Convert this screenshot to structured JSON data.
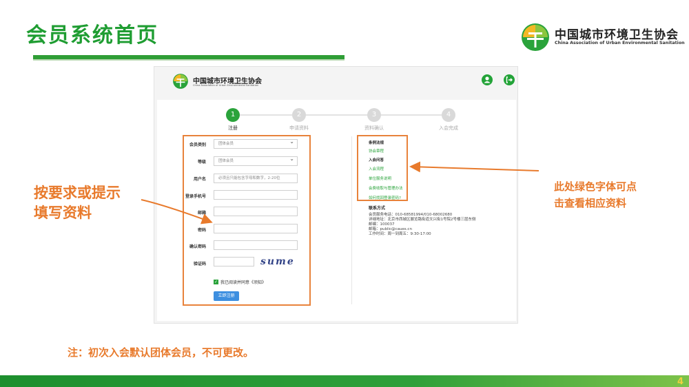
{
  "slide": {
    "title": "会员系统首页",
    "page_number": "4"
  },
  "brand": {
    "name_zh": "中国城市环境卫生协会",
    "name_en": "China Association of Urban Environmental Sanitation"
  },
  "screen": {
    "header_icons": [
      "user-icon",
      "logout-icon"
    ],
    "steps": [
      {
        "num": "1",
        "label": "注册",
        "active": true
      },
      {
        "num": "2",
        "label": "申请资料",
        "active": false
      },
      {
        "num": "3",
        "label": "资料确认",
        "active": false
      },
      {
        "num": "4",
        "label": "入会完成",
        "active": false
      }
    ],
    "form": {
      "member_type_label": "会员类别",
      "member_type_value": "团体会员",
      "level_label": "等级",
      "level_value": "团体会员",
      "username_label": "用户名",
      "username_placeholder": "必须且只能包含字母和数字，2-20位",
      "phone_label": "登录手机号",
      "email_label": "邮箱",
      "password_label": "密码",
      "confirm_label": "确认密码",
      "captcha_label": "验证码",
      "captcha_text": "sume",
      "agree_text": "我已阅读并同意《须知》",
      "submit_label": "立即注册"
    },
    "links": [
      {
        "text": "条例法规",
        "kind": "heading"
      },
      {
        "text": "协会章程",
        "kind": "link"
      },
      {
        "text": "入会问答",
        "kind": "heading"
      },
      {
        "text": "入会流程",
        "kind": "link"
      },
      {
        "text": "单位服务说明",
        "kind": "link"
      },
      {
        "text": "会费收取与管理办法",
        "kind": "link"
      },
      {
        "text": "如何找回登录密码?",
        "kind": "link"
      }
    ],
    "contact": {
      "title": "联系方式",
      "lines": [
        "会员服务电话：010-68581994/010-68002680",
        "详细地址：北京市西城区展览路街道文兴街1号院2号楼三层东侧",
        "邮编：100037",
        "邮箱：public@caues.cn",
        "工作时间：周一到周五：9:30-17:00"
      ]
    }
  },
  "annotations": {
    "left_line1": "按要求或提示",
    "left_line2": "填写资料",
    "right_line1": "此处绿色字体可点",
    "right_line2": "击查看相应资料",
    "note": "注：初次入会默认团体会员，不可更改。"
  },
  "colors": {
    "brand_green": "#1f9d32",
    "annotation_orange": "#e87a2c",
    "button_blue": "#3d8fe0",
    "page_number_yellow": "#f0d040"
  }
}
